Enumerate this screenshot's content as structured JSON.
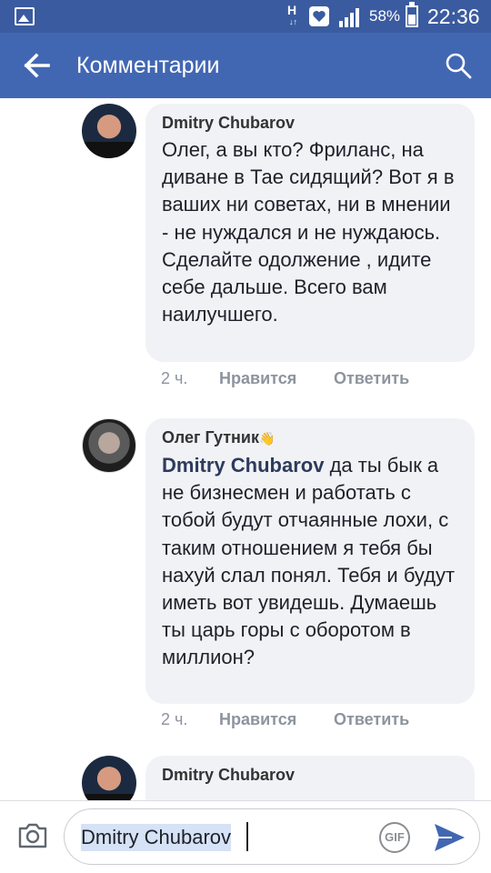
{
  "status_bar": {
    "network_label": "H",
    "network_arrows": "↓↑",
    "battery": "58%",
    "time": "22:36"
  },
  "header": {
    "title": "Комментарии"
  },
  "comments": [
    {
      "author": "Dmitry Chubarov",
      "mention": "",
      "text": "Олег, а вы кто? Фриланс, на диване в Тае сидящий? Вот я в ваших ни советах, ни в мнении - не нуждался и не нуждаюсь. Сделайте одолжение , идите себе дальше. Всего вам наилучшего.",
      "time": "2 ч.",
      "like_label": "Нравится",
      "reply_label": "Ответить"
    },
    {
      "author": "Олег Гутник",
      "badge": "👋",
      "mention": "Dmitry Chubarov",
      "text": " да ты бык а не бизнесмен и работать с тобой будут отчаянные лохи, с таким отношением я тебя бы нахуй слал понял. Тебя и будут иметь вот увидешь. Думаешь ты царь горы с оборотом в миллион?",
      "time": "2 ч.",
      "like_label": "Нравится",
      "reply_label": "Ответить"
    },
    {
      "author": "Dmitry Chubarov"
    }
  ],
  "composer": {
    "value": "Dmitry Chubarov",
    "gif_label": "GIF"
  },
  "colors": {
    "status_bar": "#3b5ba0",
    "app_bar": "#4267b2",
    "bubble": "#f1f2f6",
    "send": "#4267b2"
  }
}
